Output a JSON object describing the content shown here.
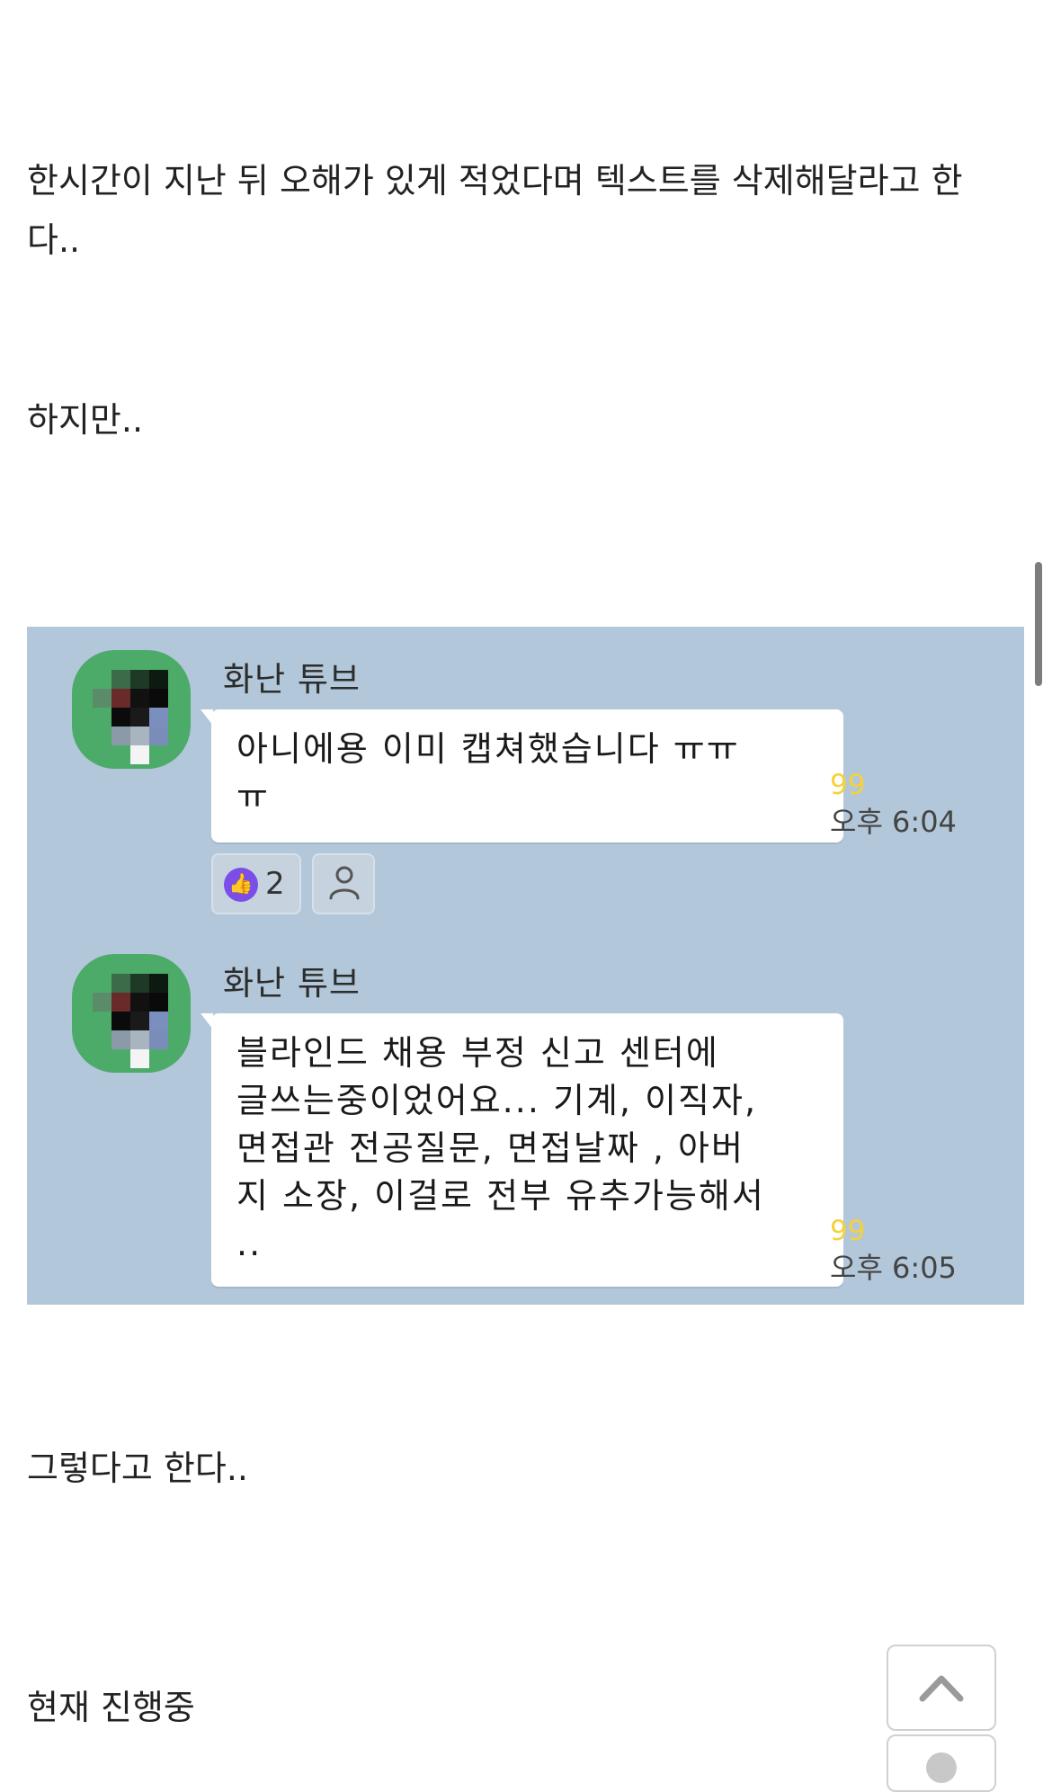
{
  "post": {
    "paragraphs": [
      "한시간이 지난 뒤 오해가 있게 적었다며 텍스트를 삭제해달라고 한다..",
      "하지만..",
      "그렇다고 한다..",
      "현재 진행중"
    ]
  },
  "chat": {
    "background_color": "#b2c7d9",
    "messages": [
      {
        "sender": "화난 튜브",
        "text": "아니에용 이미 캡쳐했습니다 ㅠㅠ\nㅠ",
        "unread": "99",
        "time": "오후 6:04",
        "reaction": {
          "icon": "thumbs-up-icon",
          "count": "2"
        }
      },
      {
        "sender": "화난 튜브",
        "text": "블라인드 채용 부정 신고 센터에\n글쓰는중이었어요... 기계, 이직자,\n면접관 전공질문, 면접날짜 , 아버\n지 소장, 이걸로 전부 유추가능해서\n..",
        "unread": "99",
        "time": "오후 6:05"
      }
    ]
  },
  "controls": {
    "scroll_top_icon": "chevron-up-icon",
    "secondary_icon": "circle-icon"
  },
  "colors": {
    "unread": "#f5d23b",
    "avatar_green": "#4cab69",
    "like_purple": "#7b4ee8"
  }
}
